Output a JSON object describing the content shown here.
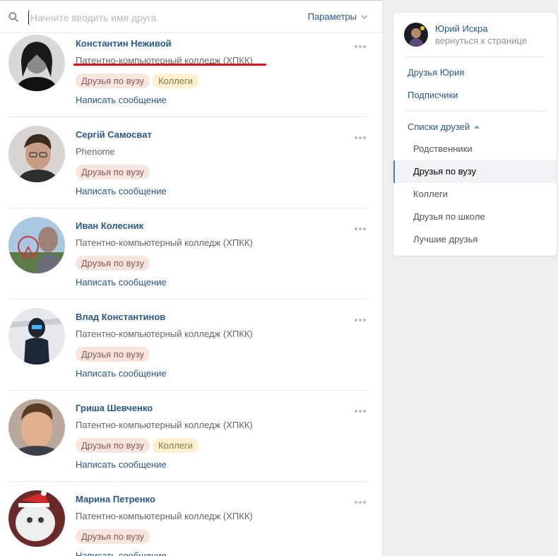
{
  "search": {
    "placeholder": "Начните вводить имя друга",
    "params_label": "Параметры"
  },
  "friends": [
    {
      "name": "Константин Неживой",
      "subtitle": "Патентно-компьютерный колледж (ХПКК)",
      "tags": [
        "Друзья по вузу",
        "Коллеги"
      ],
      "message_label": "Написать сообщение",
      "underlined": true
    },
    {
      "name": "Сергій Самосват",
      "subtitle": "Phenome",
      "tags": [
        "Друзья по вузу"
      ],
      "message_label": "Написать сообщение"
    },
    {
      "name": "Иван Колесник",
      "subtitle": "Патентно-компьютерный колледж (ХПКК)",
      "tags": [
        "Друзья по вузу"
      ],
      "message_label": "Написать сообщение"
    },
    {
      "name": "Влад Константинов",
      "subtitle": "Патентно-компьютерный колледж (ХПКК)",
      "tags": [
        "Друзья по вузу"
      ],
      "message_label": "Написать сообщение"
    },
    {
      "name": "Гриша Шевченко",
      "subtitle": "Патентно-компьютерный колледж (ХПКК)",
      "tags": [
        "Друзья по вузу",
        "Коллеги"
      ],
      "message_label": "Написать сообщение"
    },
    {
      "name": "Марина Петренко",
      "subtitle": "Патентно-компьютерный колледж (ХПКК)",
      "tags": [
        "Друзья по вузу"
      ],
      "message_label": "Написать сообщение"
    }
  ],
  "sidebar": {
    "user_name": "Юрий Искра",
    "back_label": "вернуться к странице",
    "links": [
      "Друзья Юрия",
      "Подписчики"
    ],
    "lists_label": "Списки друзей",
    "lists": [
      {
        "label": "Родственники",
        "active": false
      },
      {
        "label": "Друзья по вузу",
        "active": true
      },
      {
        "label": "Коллеги",
        "active": false
      },
      {
        "label": "Друзья по школе",
        "active": false
      },
      {
        "label": "Лучшие друзья",
        "active": false
      }
    ]
  },
  "colors": {
    "link": "#2a5885",
    "tag_uni_bg": "#f8e5e0",
    "tag_colleague_bg": "#fbf0d0",
    "underline": "#d9131e",
    "active_marker": "#5181b8"
  }
}
